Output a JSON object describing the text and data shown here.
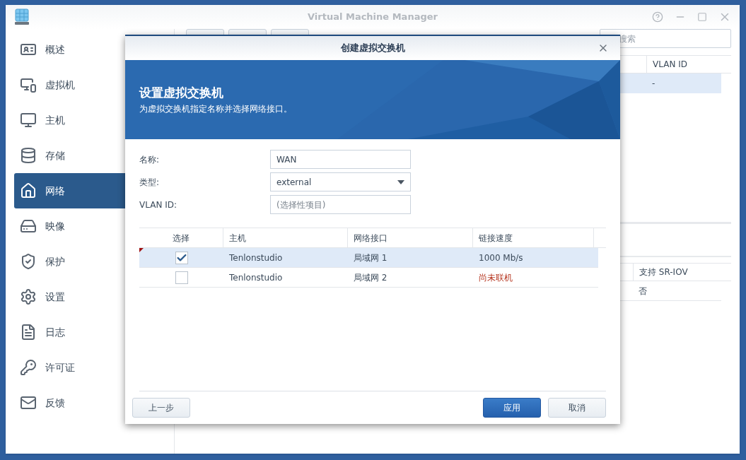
{
  "window": {
    "title": "Virtual Machine Manager"
  },
  "sidebar": {
    "items": [
      {
        "label": "概述",
        "selected": false
      },
      {
        "label": "虚拟机",
        "selected": false
      },
      {
        "label": "主机",
        "selected": false
      },
      {
        "label": "存储",
        "selected": false
      },
      {
        "label": "网络",
        "selected": true
      },
      {
        "label": "映像",
        "selected": false
      },
      {
        "label": "保护",
        "selected": false
      },
      {
        "label": "设置",
        "selected": false
      },
      {
        "label": "日志",
        "selected": false
      },
      {
        "label": "许可证",
        "selected": false
      },
      {
        "label": "反馈",
        "selected": false
      }
    ]
  },
  "main": {
    "search": {
      "placeholder": "搜索"
    },
    "upper_table": {
      "columns": [
        "VLAN ID"
      ],
      "rows": [
        {
          "cells": [
            "-"
          ],
          "selected": true
        }
      ]
    },
    "lower_table": {
      "columns": [
        "支持 SR-IOV"
      ],
      "rows": [
        {
          "cells": [
            "否"
          ],
          "selected": false
        }
      ]
    }
  },
  "dialog": {
    "title": "创建虚拟交换机",
    "banner": {
      "heading": "设置虚拟交换机",
      "subtitle": "为虚拟交换机指定名称并选择网络接口。"
    },
    "fields": [
      {
        "kind": "text",
        "label": "名称:",
        "value": "WAN"
      },
      {
        "kind": "select",
        "label": "类型:",
        "value": "external"
      },
      {
        "kind": "text",
        "label": "VLAN ID:",
        "placeholder": "(选择性项目)"
      }
    ],
    "table": {
      "columns": [
        "选择",
        "主机",
        "网络接口",
        "链接速度"
      ],
      "rows": [
        {
          "checked": true,
          "selected": true,
          "modified": true,
          "host": "Tenlonstudio",
          "interface": "局域网 1",
          "speed": "1000 Mb/s",
          "kind": "connected"
        },
        {
          "checked": false,
          "selected": false,
          "modified": false,
          "host": "Tenlonstudio",
          "interface": "局域网 2",
          "speed": "尚未联机",
          "kind": "disconnected"
        }
      ]
    },
    "buttons": [
      {
        "label": "上一步",
        "kind": "back"
      },
      {
        "label": "应用",
        "kind": "primary"
      },
      {
        "label": "取消",
        "kind": "secondary"
      }
    ]
  }
}
